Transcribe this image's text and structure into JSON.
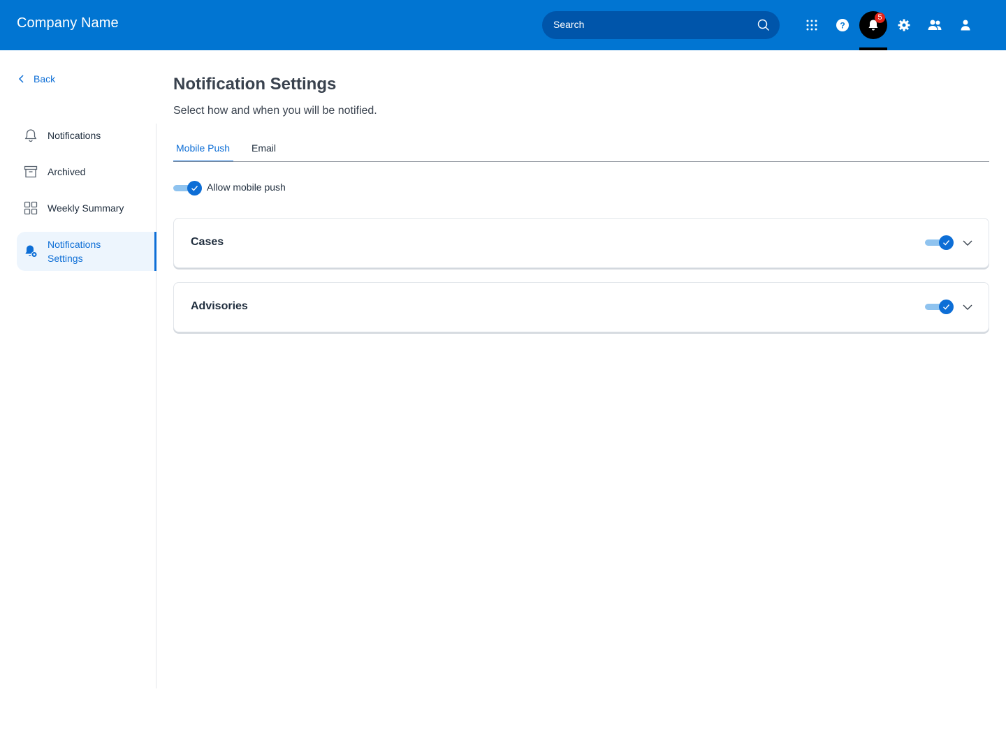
{
  "header": {
    "company_name": "Company Name",
    "search_placeholder": "Search",
    "notification_count": "5",
    "icons": [
      "apps-grid-icon",
      "help-icon",
      "bell-icon",
      "gear-icon",
      "users-icon",
      "user-icon"
    ]
  },
  "sidebar": {
    "back_label": "Back",
    "items": [
      {
        "label": "Notifications",
        "icon": "bell-outline-icon",
        "active": false
      },
      {
        "label": "Archived",
        "icon": "archive-icon",
        "active": false
      },
      {
        "label": "Weekly Summary",
        "icon": "dashboard-grid-icon",
        "active": false
      },
      {
        "label": "Notifications Settings",
        "icon": "bell-gear-icon",
        "active": true
      }
    ]
  },
  "main": {
    "title": "Notification Settings",
    "subtitle": "Select how and when you will be notified.",
    "tabs": [
      {
        "label": "Mobile Push",
        "active": true
      },
      {
        "label": "Email",
        "active": false
      }
    ],
    "allow_toggle": {
      "label": "Allow mobile push",
      "on": true
    },
    "cards": [
      {
        "title": "Cases",
        "toggle_on": true
      },
      {
        "title": "Advisories",
        "toggle_on": true
      }
    ]
  },
  "colors": {
    "header_bg": "#0175d2",
    "search_bg": "#0055aa",
    "accent": "#0d6ed6",
    "badge": "#e2231a"
  }
}
